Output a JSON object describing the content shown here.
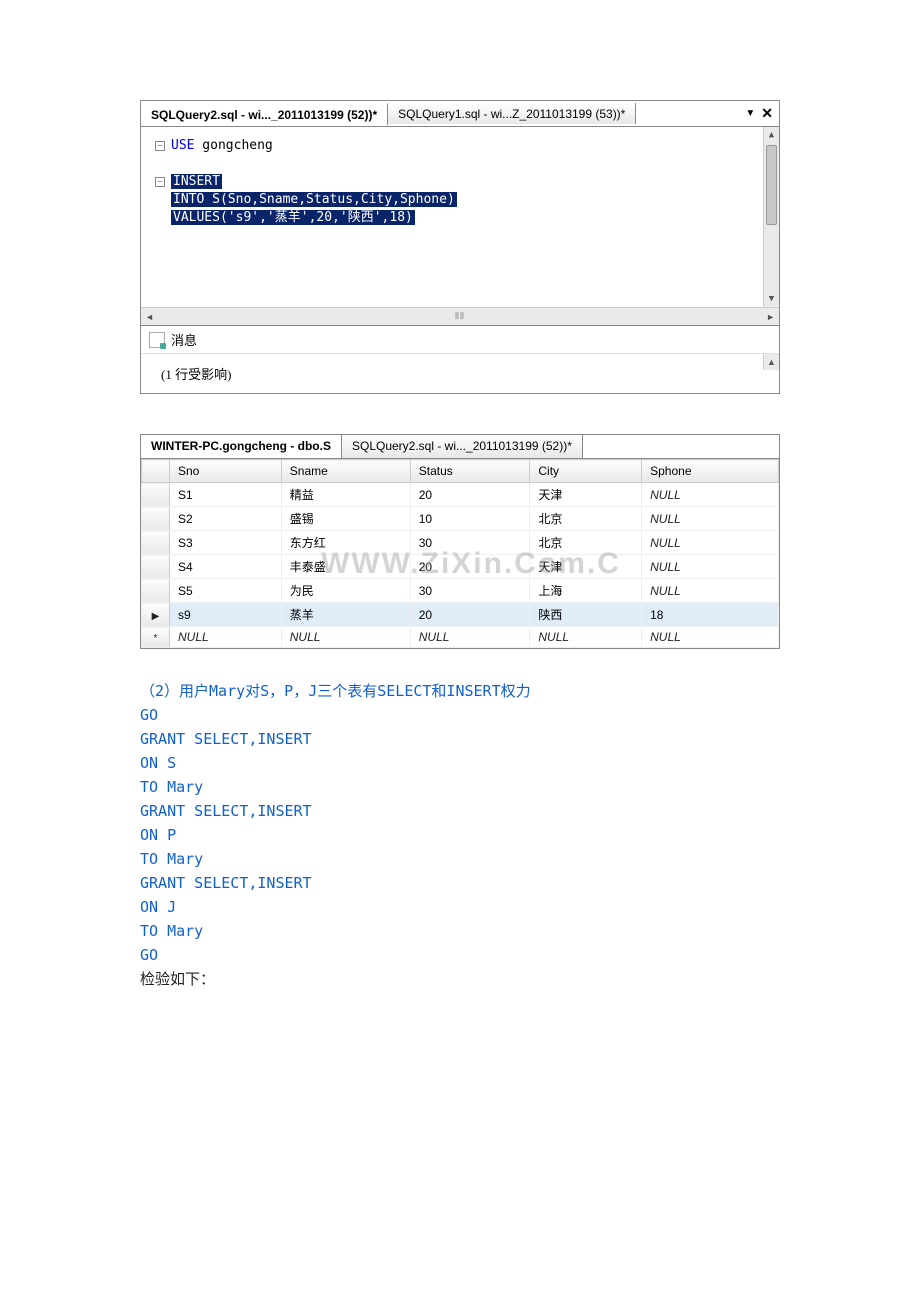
{
  "tabs": {
    "active": "SQLQuery2.sql - wi..._2011013199 (52))*",
    "inactive": "SQLQuery1.sql - wi...Z_2011013199 (53))*"
  },
  "sql_code": {
    "line1_kw": "USE",
    "line1_rest": " gongcheng",
    "line2_kw": "INSERT",
    "line3_kw": "INTO",
    "line3_rest": " S(Sno,Sname,Status,City,Sphone)",
    "line4_kw": "VALUES",
    "line4_rest": "('s9','蒸羊',20,'陕西',18)"
  },
  "msg_tab": "消息",
  "msg_text": "(1 行受影响)",
  "table_tabs": {
    "active": "WINTER-PC.gongcheng - dbo.S",
    "inactive": "SQLQuery2.sql - wi..._2011013199 (52))*"
  },
  "columns": [
    "Sno",
    "Sname",
    "Status",
    "City",
    "Sphone"
  ],
  "rows": [
    {
      "sno": "S1",
      "sname": "精益",
      "status": "20",
      "city": "天津",
      "sphone": "NULL"
    },
    {
      "sno": "S2",
      "sname": "盛锡",
      "status": "10",
      "city": "北京",
      "sphone": "NULL"
    },
    {
      "sno": "S3",
      "sname": "东方红",
      "status": "30",
      "city": "北京",
      "sphone": "NULL"
    },
    {
      "sno": "S4",
      "sname": "丰泰盛",
      "status": "20",
      "city": "天津",
      "sphone": "NULL"
    },
    {
      "sno": "S5",
      "sname": "为民",
      "status": "30",
      "city": "上海",
      "sphone": "NULL"
    },
    {
      "sno": "s9",
      "sname": "蒸羊",
      "status": "20",
      "city": "陕西",
      "sphone": "18",
      "selected": true
    },
    {
      "sno": "NULL",
      "sname": "NULL",
      "status": "NULL",
      "city": "NULL",
      "sphone": "NULL",
      "newrow": true
    }
  ],
  "watermark": "WWW.ZiXin.Com.C",
  "doc_sql": {
    "comment": "（2）用户Mary对S，P，J三个表有SELECT和INSERT权力",
    "lines": [
      "GO",
      "GRANT SELECT,INSERT",
      "ON S",
      "TO Mary",
      "GRANT SELECT,INSERT",
      "ON P",
      "TO Mary",
      "GRANT SELECT,INSERT",
      "ON J",
      "TO Mary",
      "GO"
    ],
    "check": "检验如下："
  }
}
